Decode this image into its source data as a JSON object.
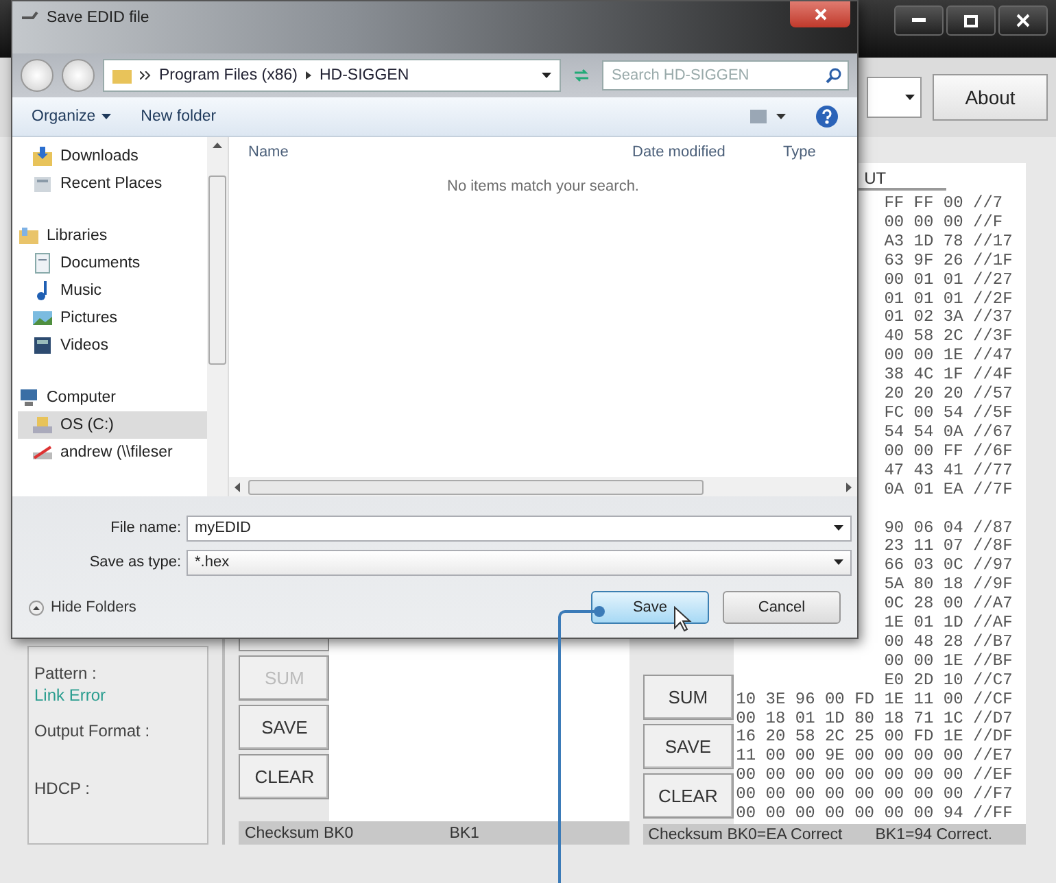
{
  "app": {
    "about_button": "About",
    "hex_panel": {
      "header": "UT",
      "upper_rows": [
        "FF FF 00 //7",
        "00 00 00 //F",
        "A3 1D 78 //17",
        "63 9F 26 //1F",
        "00 01 01 //27",
        "01 01 01 //2F",
        "01 02 3A //37",
        "40 58 2C //3F",
        "00 00 1E //47",
        "38 4C 1F //4F",
        "20 20 20 //57",
        "FC 00 54 //5F",
        "54 54 0A //67",
        "00 00 FF //6F",
        "47 43 41 //77",
        "0A 01 EA //7F"
      ],
      "lower_rows": [
        "90 06 04 //87",
        "23 11 07 //8F",
        "66 03 0C //97",
        "5A 80 18 //9F",
        "0C 28 00 //A7",
        "1E 01 1D //AF",
        "00 48 28 //B7",
        "00 00 1E //BF",
        "E0 2D 10 //C7"
      ],
      "full_rows": [
        "10 3E 96 00 FD 1E 11 00 //CF",
        "00 18 01 1D 80 18 71 1C //D7",
        "16 20 58 2C 25 00 FD 1E //DF",
        "11 00 00 9E 00 00 00 00 //E7",
        "00 00 00 00 00 00 00 00 //EF",
        "00 00 00 00 00 00 00 00 //F7",
        "00 00 00 00 00 00 00 94 //FF"
      ]
    },
    "labels": [
      {
        "text": "Pattern :",
        "kind": "label"
      },
      {
        "text": "Link Error",
        "kind": "value"
      },
      {
        "text": "Output Format :",
        "kind": "label"
      },
      {
        "text": "HDCP :",
        "kind": "label"
      }
    ],
    "middle_buttons": [
      {
        "label": "SUM",
        "disabled": true
      },
      {
        "label": "SAVE",
        "disabled": false
      },
      {
        "label": "CLEAR",
        "disabled": false
      }
    ],
    "right_buttons": [
      {
        "label": "SUM",
        "disabled": false
      },
      {
        "label": "SAVE",
        "disabled": false
      },
      {
        "label": "CLEAR",
        "disabled": false
      }
    ],
    "middle_status": [
      "Checksum BK0",
      "BK1"
    ],
    "right_status": [
      "Checksum BK0=EA Correct",
      "BK1=94 Correct."
    ]
  },
  "dialog": {
    "title": "Save EDID file",
    "breadcrumb": [
      "Program Files (x86)",
      "HD-SIGGEN"
    ],
    "search": {
      "placeholder": "Search HD-SIGGEN"
    },
    "toolbar": [
      "Organize",
      "New folder"
    ],
    "nav_items": [
      {
        "label": "Downloads",
        "kind": "downloads",
        "selected": false
      },
      {
        "label": "Recent Places",
        "kind": "recent",
        "selected": false
      },
      {
        "label": "Libraries",
        "kind": "libraries",
        "selected": false,
        "group": true
      },
      {
        "label": "Documents",
        "kind": "documents",
        "selected": false
      },
      {
        "label": "Music",
        "kind": "music",
        "selected": false
      },
      {
        "label": "Pictures",
        "kind": "pictures",
        "selected": false
      },
      {
        "label": "Videos",
        "kind": "videos",
        "selected": false
      },
      {
        "label": "Computer",
        "kind": "computer",
        "selected": false,
        "group": true
      },
      {
        "label": "OS (C:)",
        "kind": "drive",
        "selected": true
      },
      {
        "label": "andrew (\\\\fileser",
        "kind": "network",
        "selected": false
      }
    ],
    "columns": [
      "Name",
      "Date modified",
      "Type"
    ],
    "empty_message": "No items match your search.",
    "file_name": {
      "label": "File name:",
      "value": "myEDID"
    },
    "save_as_type": {
      "label": "Save as type:",
      "value": "*.hex"
    },
    "hide_folders": "Hide Folders",
    "buttons": [
      {
        "label": "Save",
        "kind": "primary"
      },
      {
        "label": "Cancel",
        "kind": "secondary"
      }
    ]
  }
}
